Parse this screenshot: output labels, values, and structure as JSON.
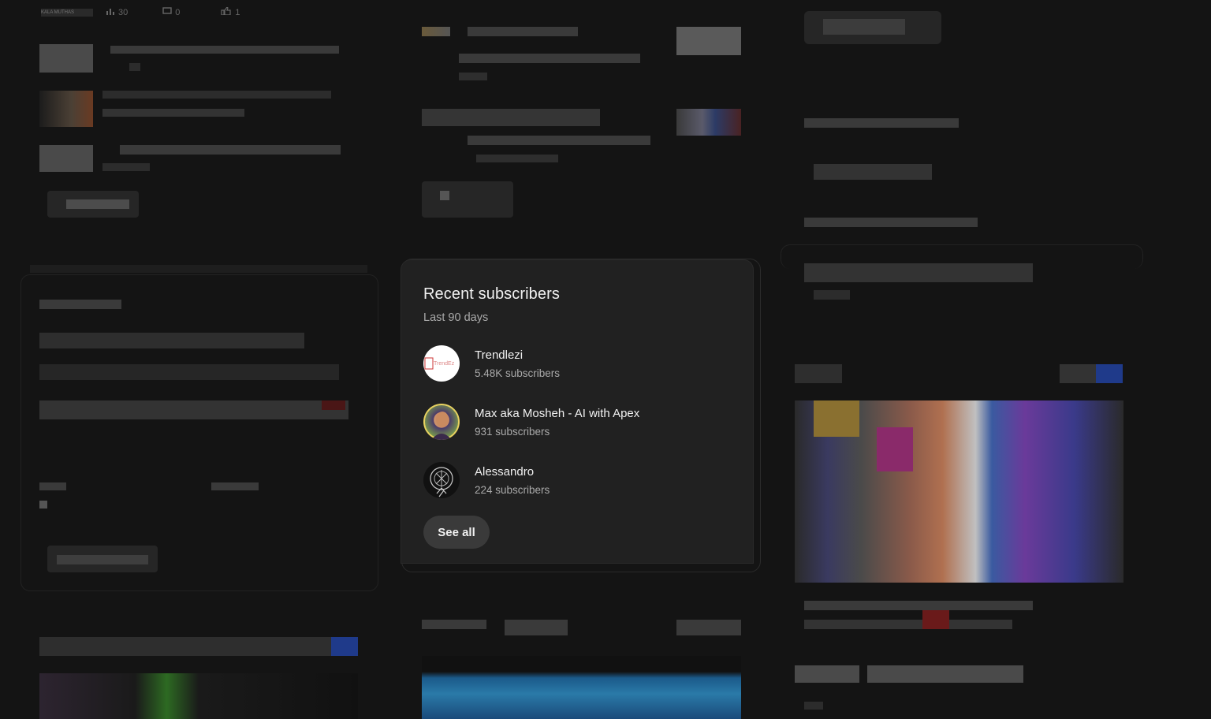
{
  "top_meta": {
    "thumb_label": "KALA MUTHAS",
    "views_count": "30",
    "comments_count": "0",
    "likes_count": "1"
  },
  "subscribers_card": {
    "title": "Recent subscribers",
    "subtitle": "Last 90 days",
    "items": [
      {
        "name": "Trendlezi",
        "count": "5.48K subscribers",
        "avatar_text": "TrendEz"
      },
      {
        "name": "Max aka Mosheh - AI with Apex",
        "count": "931 subscribers"
      },
      {
        "name": "Alessandro",
        "count": "224 subscribers"
      }
    ],
    "see_all_label": "See all"
  },
  "colors": {
    "background": "#141414",
    "card": "#212121",
    "button": "#3a3a3a",
    "title": "#f1f1f1",
    "secondary": "#aaaaaa"
  },
  "icons": [
    "chart-icon",
    "comment-icon",
    "thumb-up-icon"
  ]
}
